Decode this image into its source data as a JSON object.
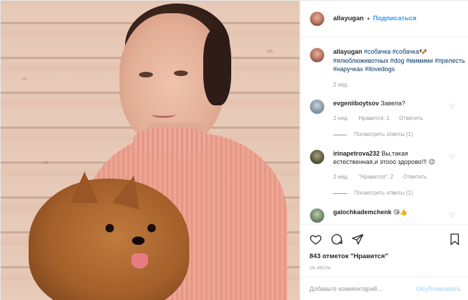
{
  "header": {
    "username": "allayugan",
    "separator": "•",
    "follow_label": "Подписаться"
  },
  "caption": {
    "username": "allayugan",
    "hashtags": [
      "#собачка",
      "#собачка🐶",
      "#ялюблюживотных",
      "#dog",
      "#мимими",
      "#прелесть",
      "#наручках",
      "#ilovedogs"
    ],
    "time": "2 нед."
  },
  "comments": [
    {
      "username": "evgeniiboytsov",
      "text": "Завела?",
      "time": "2 нед.",
      "likes_label": "Нравится: 1",
      "reply_label": "Ответить",
      "view_replies": "Посмотреть ответы (1)"
    },
    {
      "username": "irinapetrova232",
      "text": "Вы,такая естественная,и этооо здорово!!! 😉",
      "time": "2 нед.",
      "likes_label": "\"Нравится\": 2",
      "reply_label": "Ответить",
      "view_replies": "Посмотреть ответы (1)"
    },
    {
      "username": "galochkademchenk",
      "text": "😘👍",
      "time": "",
      "likes_label": "",
      "reply_label": "",
      "view_replies": ""
    }
  ],
  "actions": {
    "likes_text": "843 отметок \"Нравится\"",
    "date": "28 июль"
  },
  "add_comment": {
    "placeholder": "Добавьте комментарий...",
    "post_label": "Опубликовать"
  },
  "colors": {
    "link_blue": "#3897f0",
    "hashtag": "#003569",
    "muted": "#999999",
    "post_disabled": "#b2dffc"
  },
  "icons": [
    "heart-icon",
    "comment-icon",
    "share-icon",
    "bookmark-icon"
  ]
}
